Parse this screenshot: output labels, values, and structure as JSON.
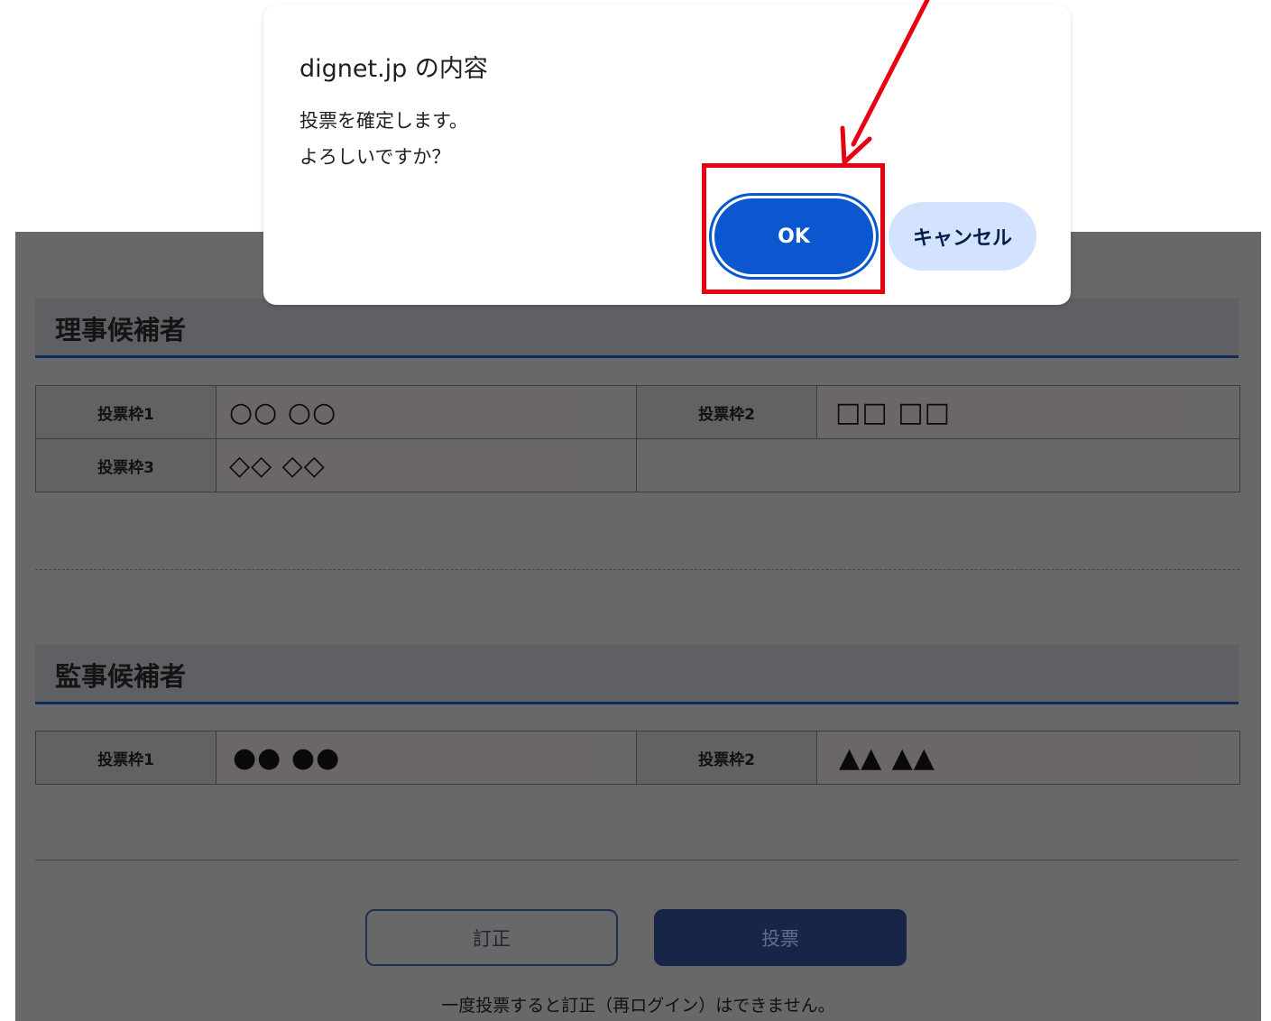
{
  "dialog": {
    "title": "dignet.jp の内容",
    "message_line1": "投票を確定します。",
    "message_line2": "よろしいですか？",
    "ok_label": "OK",
    "cancel_label": "キャンセル"
  },
  "sections": {
    "directors": {
      "title": "理事候補者",
      "slot1_label": "投票枠1",
      "slot1_value": "○○ ○○",
      "slot2_label": "投票枠2",
      "slot2_value": "□□ □□",
      "slot3_label": "投票枠3",
      "slot3_value": "◇◇ ◇◇"
    },
    "auditors": {
      "title": "監事候補者",
      "slot1_label": "投票枠1",
      "slot1_value": "●● ●●",
      "slot2_label": "投票枠2",
      "slot2_value": "▲▲ ▲▲"
    }
  },
  "actions": {
    "correct_label": "訂正",
    "vote_label": "投票",
    "notice": "一度投票すると訂正（再ログイン）はできません。"
  },
  "colors": {
    "ok_button": "#0b57d0",
    "cancel_button": "#d3e3fd",
    "highlight": "#e60012",
    "section_underline": "#0f2b5c"
  }
}
